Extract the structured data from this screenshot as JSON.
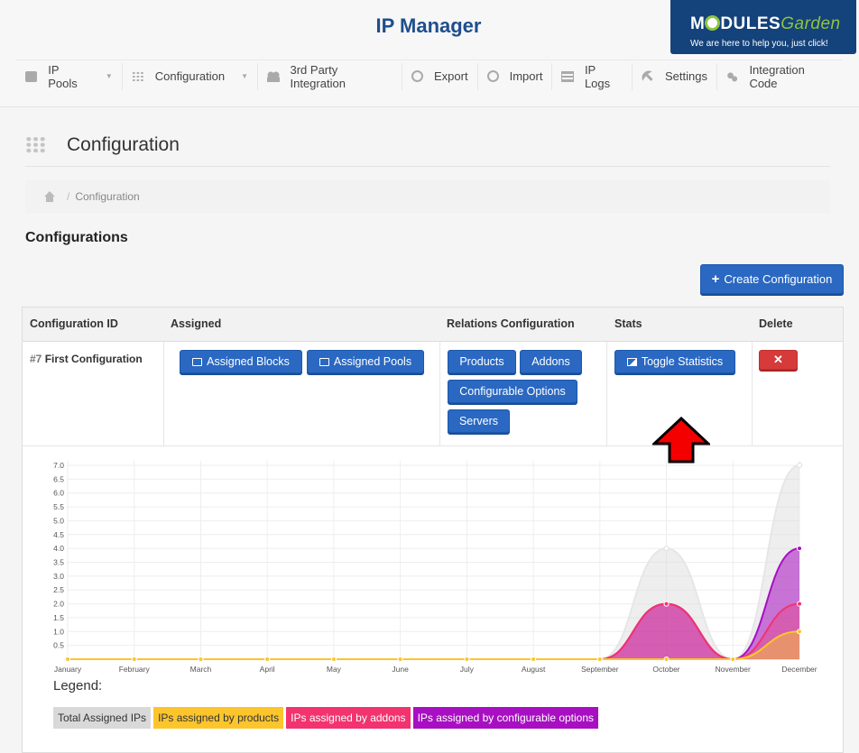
{
  "app": {
    "title": "IP Manager"
  },
  "brand": {
    "name_part1": "M",
    "name_part2": "DULES",
    "name_part3": "Garden",
    "tagline": "We are here to help you, just click!"
  },
  "nav": [
    {
      "label": "IP Pools",
      "icon": "box-icon",
      "dropdown": true
    },
    {
      "label": "Configuration",
      "icon": "grid-icon",
      "dropdown": true
    },
    {
      "label": "3rd Party Integration",
      "icon": "users-icon",
      "dropdown": false
    },
    {
      "label": "Export",
      "icon": "export-icon",
      "dropdown": false
    },
    {
      "label": "Import",
      "icon": "import-icon",
      "dropdown": false
    },
    {
      "label": "IP Logs",
      "icon": "list-icon",
      "dropdown": false
    },
    {
      "label": "Settings",
      "icon": "wrench-icon",
      "dropdown": false
    },
    {
      "label": "Integration Code",
      "icon": "cogs-icon",
      "dropdown": false
    }
  ],
  "page": {
    "title": "Configuration",
    "breadcrumb_sep": "/",
    "breadcrumb": "Configuration",
    "section_title": "Configurations",
    "create_button": "Create Configuration"
  },
  "table": {
    "headers": [
      "Configuration ID",
      "Assigned",
      "Relations Configuration",
      "Stats",
      "Delete"
    ],
    "row": {
      "id_hash": "#7",
      "name": "First Configuration",
      "assigned_blocks": "Assigned Blocks",
      "assigned_pools": "Assigned Pools",
      "products": "Products",
      "addons": "Addons",
      "configurable_options": "Configurable Options",
      "servers": "Servers",
      "toggle_stats": "Toggle Statistics",
      "delete_symbol": "✕"
    }
  },
  "legend": {
    "title": "Legend:",
    "items": [
      {
        "label": "Total Assigned IPs",
        "color": "#d9d9d9",
        "text_color": "#333333"
      },
      {
        "label": "IPs assigned by products",
        "color": "#fcc52c",
        "text_color": "#333333"
      },
      {
        "label": "IPs assigned by addons",
        "color": "#f2336f",
        "text_color": "#ffffff"
      },
      {
        "label": "IPs assigned by configurable options",
        "color": "#a80fc2",
        "text_color": "#ffffff"
      }
    ]
  },
  "chart_data": {
    "type": "area",
    "categories": [
      "January",
      "February",
      "March",
      "April",
      "May",
      "June",
      "July",
      "August",
      "September",
      "October",
      "November",
      "December"
    ],
    "yticks": [
      "0.5",
      "1.0",
      "1.5",
      "2.0",
      "2.5",
      "3.0",
      "3.5",
      "4.0",
      "4.5",
      "5.0",
      "5.5",
      "6.0",
      "6.5",
      "7.0"
    ],
    "ylim": [
      0,
      7
    ],
    "grid": true,
    "series": [
      {
        "name": "Total Assigned IPs",
        "color": "#d9d9d9",
        "values": [
          0,
          0,
          0,
          0,
          0,
          0,
          0,
          0,
          0,
          4,
          0,
          7
        ]
      },
      {
        "name": "IPs assigned by products",
        "color": "#fcc52c",
        "values": [
          0,
          0,
          0,
          0,
          0,
          0,
          0,
          0,
          0,
          0,
          0,
          1
        ]
      },
      {
        "name": "IPs assigned by addons",
        "color": "#f2336f",
        "values": [
          0,
          0,
          0,
          0,
          0,
          0,
          0,
          0,
          0,
          2,
          0,
          2
        ]
      },
      {
        "name": "IPs assigned by configurable options",
        "color": "#a80fc2",
        "values": [
          0,
          0,
          0,
          0,
          0,
          0,
          0,
          0,
          0,
          2,
          0,
          4
        ]
      }
    ]
  }
}
